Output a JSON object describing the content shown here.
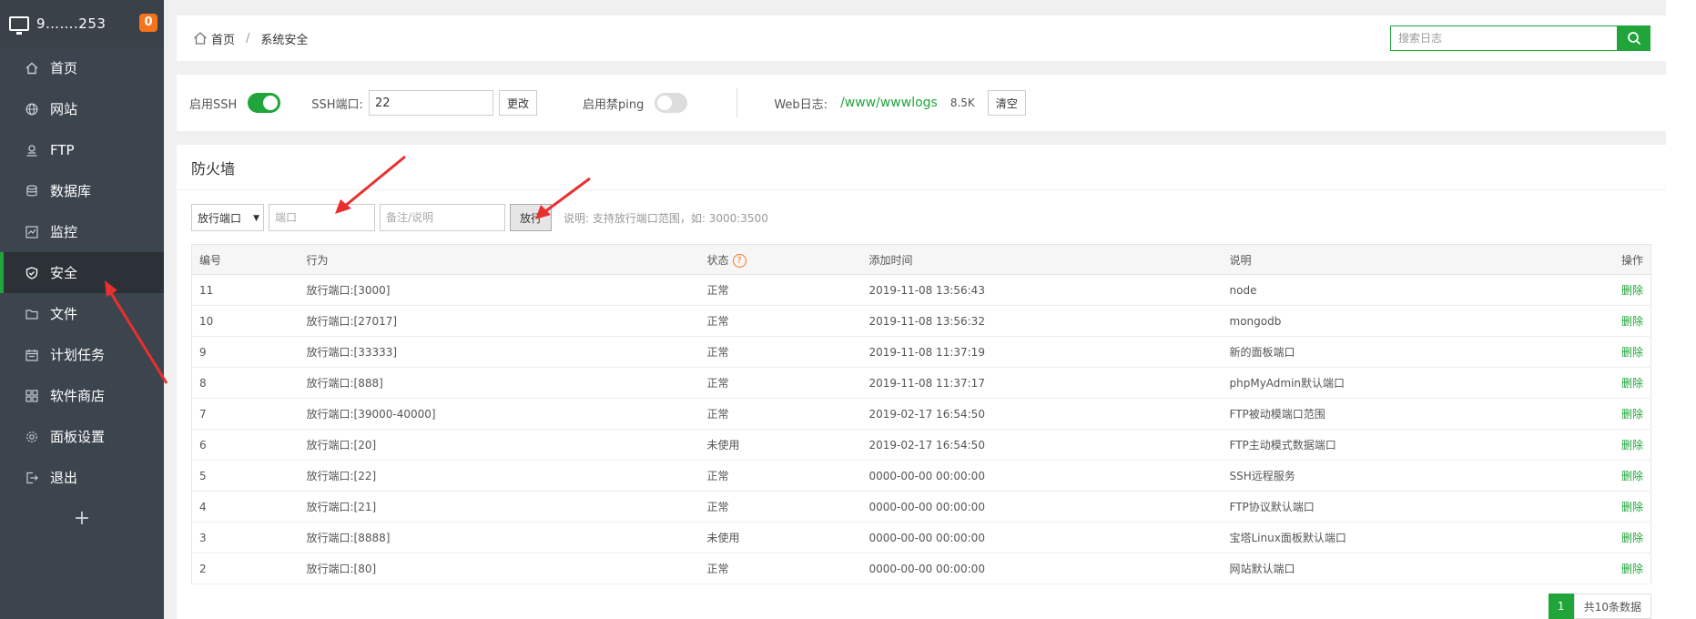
{
  "sidebar": {
    "ip": "9…….253",
    "badge": "0",
    "items": [
      {
        "label": "首页",
        "icon": "home-icon"
      },
      {
        "label": "网站",
        "icon": "globe-icon"
      },
      {
        "label": "FTP",
        "icon": "ftp-icon"
      },
      {
        "label": "数据库",
        "icon": "database-icon"
      },
      {
        "label": "监控",
        "icon": "monitor-icon"
      },
      {
        "label": "安全",
        "icon": "shield-icon"
      },
      {
        "label": "文件",
        "icon": "folder-icon"
      },
      {
        "label": "计划任务",
        "icon": "calendar-icon"
      },
      {
        "label": "软件商店",
        "icon": "grid-icon"
      },
      {
        "label": "面板设置",
        "icon": "gear-icon"
      },
      {
        "label": "退出",
        "icon": "logout-icon"
      }
    ],
    "add": "+"
  },
  "breadcrumb": {
    "home": "首页",
    "sep": "/",
    "current": "系统安全"
  },
  "search": {
    "placeholder": "搜索日志"
  },
  "ssh": {
    "enable_label": "启用SSH",
    "port_label": "SSH端口:",
    "port_value": "22",
    "change_button": "更改",
    "ping_label": "启用禁ping",
    "weblog_label": "Web日志:",
    "weblog_path": "/www/wwwlogs",
    "weblog_size": "8.5K",
    "clear_button": "清空"
  },
  "firewall": {
    "title": "防火墙",
    "select_value": "放行端口",
    "port_placeholder": "端口",
    "note_placeholder": "备注/说明",
    "allow_button": "放行",
    "hint": "说明: 支持放行端口范围，如: 3000:3500",
    "columns": [
      "编号",
      "行为",
      "状态",
      "添加时间",
      "说明",
      "操作"
    ],
    "rows": [
      {
        "id": "11",
        "action": "放行端口:[3000]",
        "status": "正常",
        "time": "2019-11-08 13:56:43",
        "desc": "node",
        "op": "删除"
      },
      {
        "id": "10",
        "action": "放行端口:[27017]",
        "status": "正常",
        "time": "2019-11-08 13:56:32",
        "desc": "mongodb",
        "op": "删除"
      },
      {
        "id": "9",
        "action": "放行端口:[33333]",
        "status": "正常",
        "time": "2019-11-08 11:37:19",
        "desc": "新的面板端口",
        "op": "删除"
      },
      {
        "id": "8",
        "action": "放行端口:[888]",
        "status": "正常",
        "time": "2019-11-08 11:37:17",
        "desc": "phpMyAdmin默认端口",
        "op": "删除"
      },
      {
        "id": "7",
        "action": "放行端口:[39000-40000]",
        "status": "正常",
        "time": "2019-02-17 16:54:50",
        "desc": "FTP被动模端口范围",
        "op": "删除"
      },
      {
        "id": "6",
        "action": "放行端口:[20]",
        "status": "未使用",
        "time": "2019-02-17 16:54:50",
        "desc": "FTP主动模式数据端口",
        "op": "删除"
      },
      {
        "id": "5",
        "action": "放行端口:[22]",
        "status": "正常",
        "time": "0000-00-00 00:00:00",
        "desc": "SSH远程服务",
        "op": "删除"
      },
      {
        "id": "4",
        "action": "放行端口:[21]",
        "status": "正常",
        "time": "0000-00-00 00:00:00",
        "desc": "FTP协议默认端口",
        "op": "删除"
      },
      {
        "id": "3",
        "action": "放行端口:[8888]",
        "status": "未使用",
        "time": "0000-00-00 00:00:00",
        "desc": "宝塔Linux面板默认端口",
        "op": "删除"
      },
      {
        "id": "2",
        "action": "放行端口:[80]",
        "status": "正常",
        "time": "0000-00-00 00:00:00",
        "desc": "网站默认端口",
        "op": "删除"
      }
    ],
    "pager": {
      "current": "1",
      "total": "共10条数据"
    }
  },
  "colors": {
    "accent": "#20a53a",
    "sidebar": "#3c444d",
    "badge": "#f7731c",
    "arrow": "#e8312f"
  }
}
